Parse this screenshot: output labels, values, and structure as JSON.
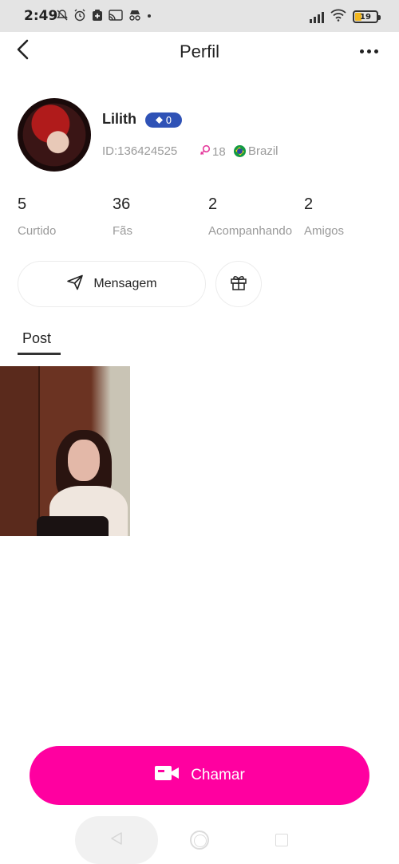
{
  "status_bar": {
    "time": "2:49",
    "left_icons": [
      "notifications-off-icon",
      "alarm-icon",
      "app-icon",
      "cast-icon",
      "incognito-icon",
      "dot-icon"
    ],
    "battery": "19",
    "right_icons": [
      "signal-icon",
      "wifi-icon",
      "battery-icon"
    ]
  },
  "header": {
    "title": "Perfil",
    "back_icon": "back-icon",
    "more_icon": "more-icon"
  },
  "profile": {
    "name": "Lilith",
    "level": "0",
    "id_text": "ID:136424525",
    "age": "18",
    "country": "Brazil"
  },
  "stats": [
    {
      "value": "5",
      "label": "Curtido"
    },
    {
      "value": "36",
      "label": "Fãs"
    },
    {
      "value": "2",
      "label": "Acompanhando"
    },
    {
      "value": "2",
      "label": "Amigos"
    }
  ],
  "actions": {
    "message_label": "Mensagem",
    "gift_icon": "gift-icon"
  },
  "tabs": {
    "post_label": "Post"
  },
  "call": {
    "label": "Chamar",
    "icon": "video-camera-icon"
  },
  "colors": {
    "accent": "#ff00a0",
    "badge": "#2f52b6",
    "muted_text": "#9a9a9a"
  }
}
